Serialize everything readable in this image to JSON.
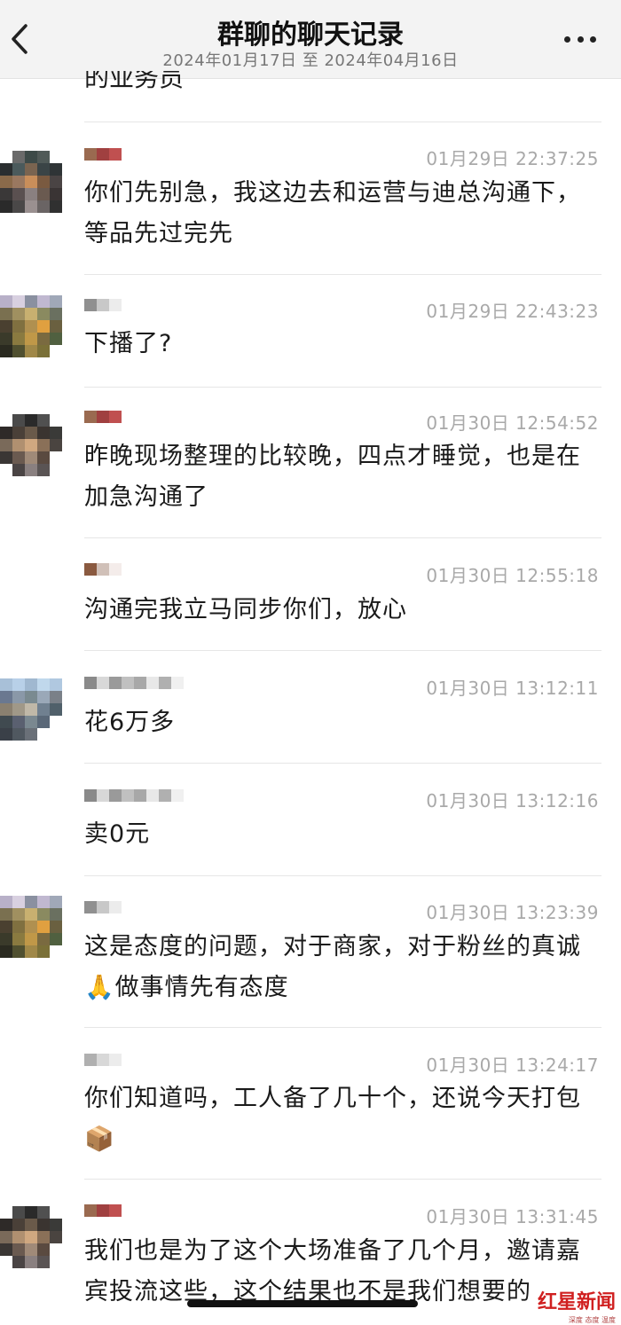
{
  "header": {
    "title": "群聊的聊天记录",
    "date_range": "2024年01月17日 至 2024年04月16日",
    "back_icon": "chevron-left-icon",
    "more_icon": "ellipsis-icon"
  },
  "partial_text": "的业务员",
  "messages": [
    {
      "time": "01月29日 22:37:25",
      "text": "你们先别急，我这边去和运营与迪总沟通下，等品先过完先"
    },
    {
      "time": "01月29日 22:43:23",
      "text": "下播了?"
    },
    {
      "time": "01月30日 12:54:52",
      "text": "昨晚现场整理的比较晚，四点才睡觉，也是在加急沟通了"
    },
    {
      "time": "01月30日 12:55:18",
      "text": "沟通完我立马同步你们，放心"
    },
    {
      "time": "01月30日 13:12:11",
      "text": "花6万多"
    },
    {
      "time": "01月30日 13:12:16",
      "text": "卖0元"
    },
    {
      "time": "01月30日 13:23:39",
      "text": "这是态度的问题，对于商家，对于粉丝的真诚🙏做事情先有态度"
    },
    {
      "time": "01月30日 13:24:17",
      "text": "你们知道吗，工人备了几十个，还说今天打包📦"
    },
    {
      "time": "01月30日 13:31:45",
      "text": "我们也是为了这个大场准备了几个月，邀请嘉宾投流这些，这个结果也不是我们想要的"
    }
  ],
  "watermark": {
    "logo": "红星新闻",
    "tagline": "深度 态度 温度"
  },
  "colors": {
    "header_bg": "#f3f3f3",
    "timestamp": "#a9a9a9",
    "divider": "#e6e6e6"
  }
}
